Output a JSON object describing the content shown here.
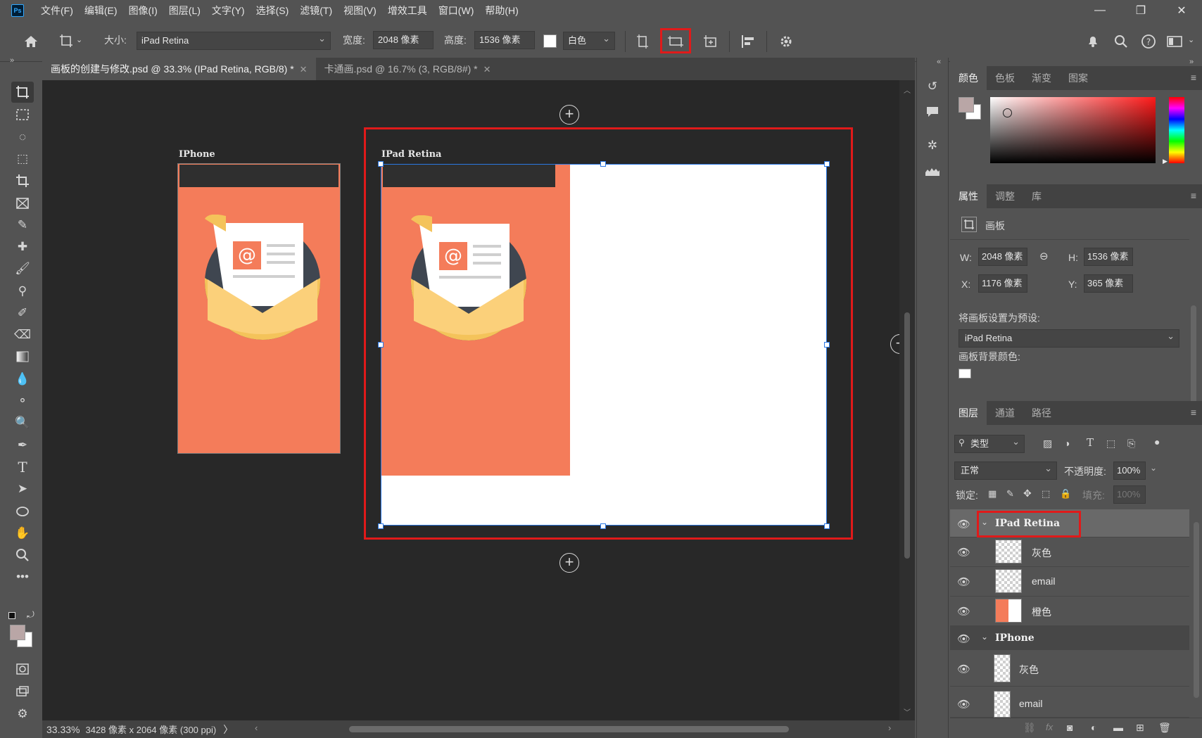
{
  "app": {
    "logo": "Ps"
  },
  "menu": [
    "文件(F)",
    "编辑(E)",
    "图像(I)",
    "图层(L)",
    "文字(Y)",
    "选择(S)",
    "滤镜(T)",
    "视图(V)",
    "增效工具",
    "窗口(W)",
    "帮助(H)"
  ],
  "window_controls": {
    "minimize": "—",
    "restore": "❐",
    "close": "✕"
  },
  "options": {
    "size_label": "大小:",
    "size_value": "iPad Retina",
    "width_label": "宽度:",
    "width_value": "2048 像素",
    "height_label": "高度:",
    "height_value": "1536 像素",
    "color_name": "白色"
  },
  "tabs": [
    {
      "label": "画板的创建与修改.psd @ 33.3% (IPad Retina, RGB/8) *",
      "close": "✕"
    },
    {
      "label": "卡通画.psd @ 16.7% (3, RGB/8#) *",
      "close": "✕"
    }
  ],
  "canvas": {
    "artboard_iphone_label": "IPhone",
    "artboard_ipad_label": "IPad Retina",
    "email_glyph": "@",
    "plus": "+",
    "artboard_colors": {
      "orange": "#f47c5a",
      "dark": "#2f2f2f",
      "white": "#ffffff"
    }
  },
  "status": {
    "zoom": "33.33%",
    "doc_info": "3428 像素 x 2064 像素 (300 ppi)",
    "arrow": "〉"
  },
  "color_panel": {
    "tabs": [
      "颜色",
      "色板",
      "渐变",
      "图案"
    ],
    "foreground": "#b9a6a6",
    "background": "#ffffff"
  },
  "properties_panel": {
    "tabs": [
      "属性",
      "调整",
      "库"
    ],
    "type_label": "画板",
    "w_label": "W:",
    "w_value": "2048 像素",
    "h_label": "H:",
    "h_value": "1536 像素",
    "x_label": "X:",
    "x_value": "1176 像素",
    "y_label": "Y:",
    "y_value": "365 像素",
    "preset_label": "将画板设置为预设:",
    "preset_value": "iPad Retina",
    "bg_label": "画板背景颜色:"
  },
  "layers_panel": {
    "tabs": [
      "图层",
      "通道",
      "路径"
    ],
    "filter_label": "类型",
    "blend_mode": "正常",
    "opacity_label": "不透明度:",
    "opacity_value": "100%",
    "lock_label": "锁定:",
    "fill_label": "填充:",
    "fill_value": "100%",
    "layers": [
      {
        "name": "IPad Retina",
        "kind": "group"
      },
      {
        "name": "灰色",
        "kind": "layer"
      },
      {
        "name": "email",
        "kind": "layer"
      },
      {
        "name": "橙色",
        "kind": "layer"
      },
      {
        "name": "IPhone",
        "kind": "group"
      },
      {
        "name": "灰色",
        "kind": "layer"
      },
      {
        "name": "email",
        "kind": "layer"
      }
    ]
  }
}
